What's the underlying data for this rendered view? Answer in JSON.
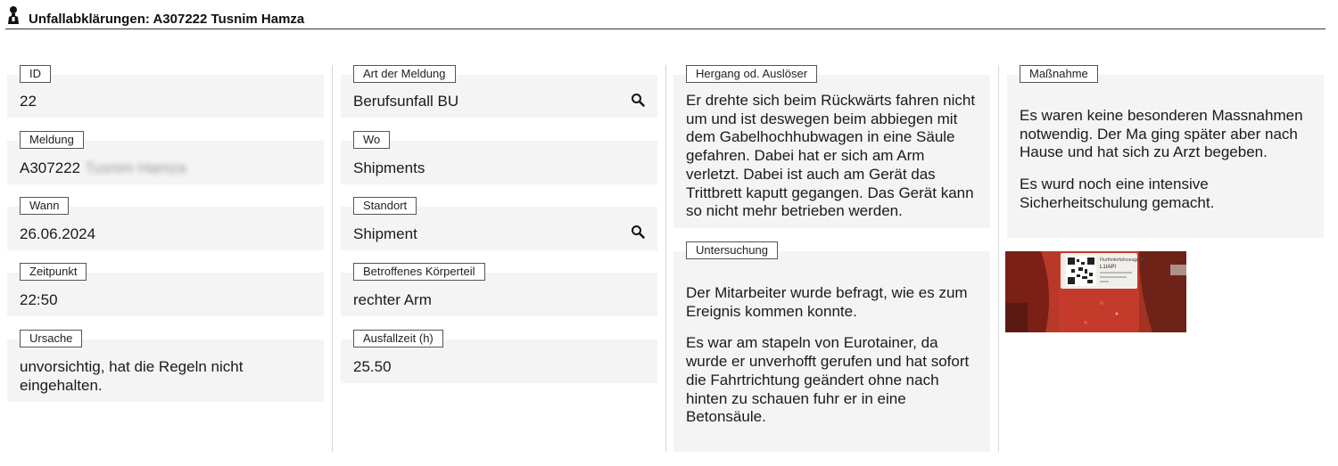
{
  "header": {
    "title": "Unfallabklärungen: A307222 Tusnim Hamza",
    "icon": "person-icon"
  },
  "col1": {
    "id": {
      "label": "ID",
      "value": "22"
    },
    "meldung": {
      "label": "Meldung",
      "value": "A307222",
      "value_blurred": "Tusnim Hamza"
    },
    "wann": {
      "label": "Wann",
      "value": "26.06.2024"
    },
    "zeitpunkt": {
      "label": "Zeitpunkt",
      "value": "22:50"
    },
    "ursache": {
      "label": "Ursache",
      "value_line1": "unvorsichtig, hat die Regeln nicht",
      "value_line2": "eingehalten."
    }
  },
  "col2": {
    "art": {
      "label": "Art der Meldung",
      "value": "Berufsunfall BU"
    },
    "wo": {
      "label": "Wo",
      "value": "Shipments"
    },
    "standort": {
      "label": "Standort",
      "value": "Shipment"
    },
    "koerperteil": {
      "label": "Betroffenes Körperteil",
      "value": "rechter Arm"
    },
    "ausfallzeit": {
      "label": "Ausfallzeit (h)",
      "value": "25.50"
    }
  },
  "col3": {
    "hergang": {
      "label": "Hergang od. Auslöser",
      "lines": [
        "Er drehte sich beim Rückwärts fahren nicht",
        "um und ist deswegen beim abbiegen mit",
        "dem Gabelhochhubwagen in eine Säule",
        "gefahren. Dabei hat er sich am Arm",
        "verletzt. Dabei ist auch am Gerät  das",
        "Trittbrett kaputt gegangen. Das Gerät kann",
        "so nicht mehr betrieben werden."
      ]
    },
    "untersuchung": {
      "label": "Untersuchung",
      "para1": [
        "Der Mitarbeiter wurde befragt, wie es zum",
        "Ereignis kommen konnte."
      ],
      "para2": [
        "Es war am stapeln von Eurotainer, da",
        "wurde er unverhofft gerufen und hat sofort",
        "die Fahrtrichtung geändert ohne nach",
        "hinten zu schauen fuhr er in eine",
        "Betonsäule."
      ]
    }
  },
  "col4": {
    "massnahme": {
      "label": "Maßnahme",
      "para1": [
        "Es waren keine besonderen Massnahmen",
        "notwendig. Der Ma ging später aber nach",
        "Hause und hat sich zu Arzt begeben."
      ],
      "para2": [
        "Es wurd noch eine intensive",
        "Sicherheitschulung gemacht."
      ]
    },
    "photo": {
      "sticker_title": "Flurförderfahrzeuge BU",
      "sticker_code": "L1IAPI",
      "colors": {
        "frame": "#c62f22",
        "sticker": "#f1efea"
      }
    }
  },
  "icons": {
    "search": "search-icon"
  }
}
